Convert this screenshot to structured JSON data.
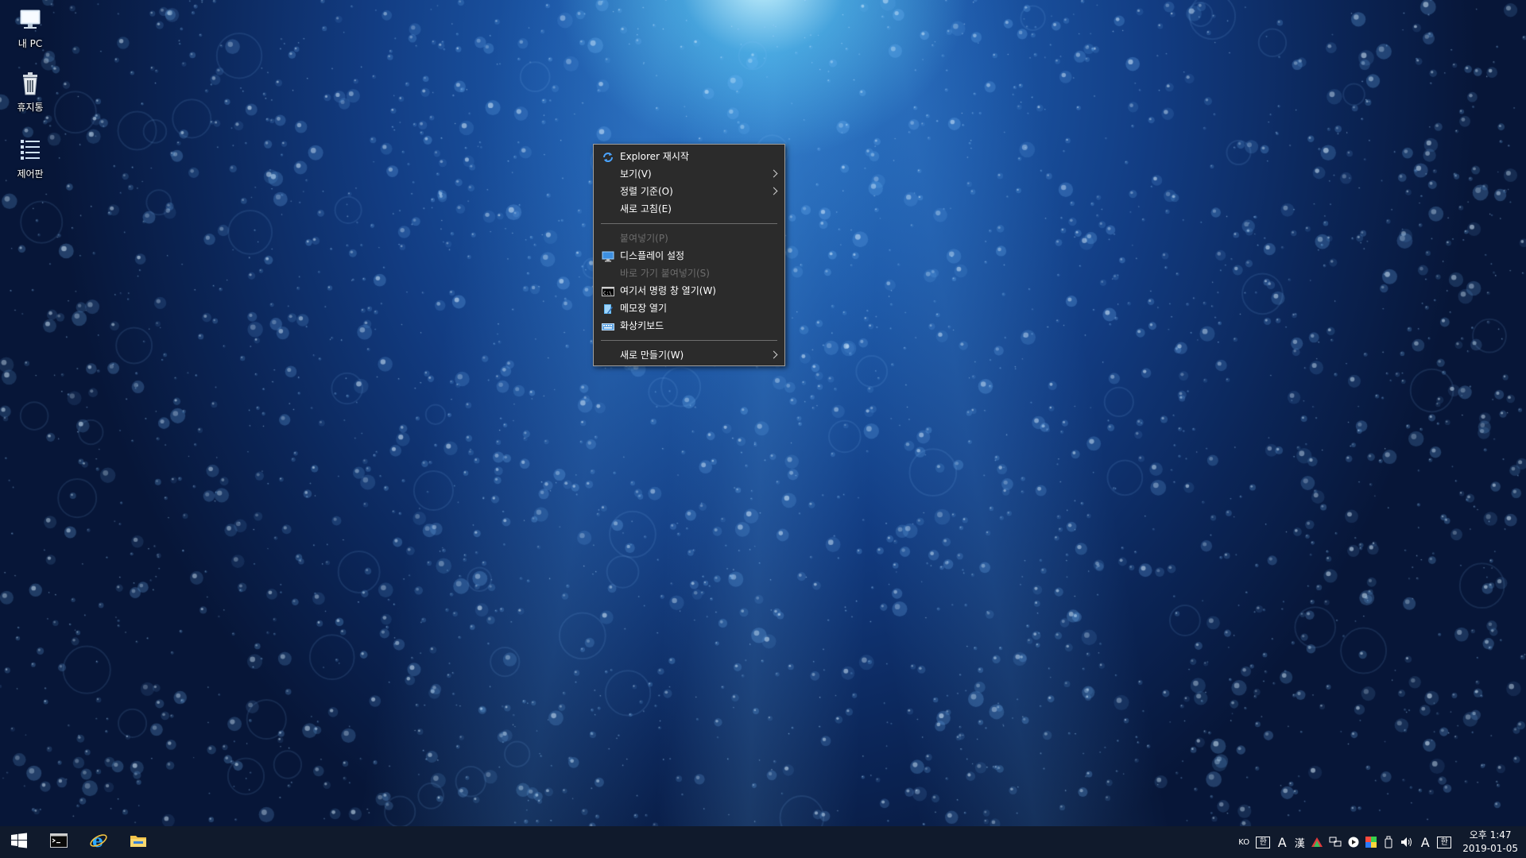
{
  "desktop": {
    "icons": [
      {
        "label": "내 PC",
        "icon": "computer-icon"
      },
      {
        "label": "휴지통",
        "icon": "recycle-bin-icon"
      },
      {
        "label": "제어판",
        "icon": "control-panel-icon"
      }
    ]
  },
  "context_menu": {
    "items": [
      {
        "label": "Explorer 재시작",
        "icon": "refresh-icon",
        "enabled": true
      },
      {
        "label": "보기(V)",
        "submenu": true,
        "enabled": true
      },
      {
        "label": "정렬 기준(O)",
        "submenu": true,
        "enabled": true
      },
      {
        "label": "새로 고침(E)",
        "enabled": true
      },
      {
        "label": "붙여넣기(P)",
        "enabled": false
      },
      {
        "label": "디스플레이 설정",
        "icon": "display-icon",
        "enabled": true
      },
      {
        "label": "바로 가기 붙여넣기(S)",
        "enabled": false
      },
      {
        "label": "여기서 명령 창 열기(W)",
        "icon": "command-prompt-icon",
        "enabled": true
      },
      {
        "label": "메모장 열기",
        "icon": "notepad-icon",
        "enabled": true
      },
      {
        "label": "화상키보드",
        "icon": "keyboard-icon",
        "enabled": true
      },
      {
        "label": "새로 만들기(W)",
        "submenu": true,
        "enabled": true
      }
    ]
  },
  "taskbar": {
    "buttons": [
      {
        "name": "start-button",
        "icon": "windows-logo-icon"
      },
      {
        "name": "terminal-button",
        "icon": "terminal-icon"
      },
      {
        "name": "internet-explorer-button",
        "icon": "internet-explorer-icon"
      },
      {
        "name": "file-explorer-button",
        "icon": "folder-icon"
      }
    ],
    "tray": {
      "language": "KO",
      "ime_hangul": "한",
      "ime_a": "A",
      "ime_hanja": "漢",
      "ime_a2": "A",
      "ime_extra": "한",
      "time": "오후 1:47",
      "date": "2019-01-05"
    }
  },
  "colors": {
    "menu_bg": "#2b2b2b",
    "menu_border": "#a0a0a0",
    "taskbar_bg": "#101a2c",
    "disabled_text": "#6d6d6d"
  }
}
